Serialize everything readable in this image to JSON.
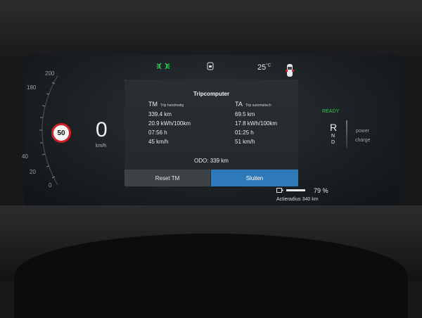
{
  "status_bar": {
    "temperature": "25",
    "temperature_unit": "°C",
    "icons": [
      "headlights-icon",
      "car-front-icon",
      "car-top-view-icon"
    ]
  },
  "speedometer": {
    "speed": "0",
    "unit": "km/h",
    "speed_limit": "50",
    "scale_labels": [
      "200",
      "180",
      "40",
      "20",
      "0"
    ]
  },
  "trip_computer": {
    "title": "Tripcomputer",
    "tm": {
      "code": "TM",
      "name": "Trip handmatig",
      "rows": [
        "339.4 km",
        "20.9 kWh/100km",
        "07:56 h",
        "45 km/h"
      ]
    },
    "ta": {
      "code": "TA",
      "name": "Trip automatisch",
      "rows": [
        "69.5 km",
        "17.8 kWh/100km",
        "01:25 h",
        "51 km/h"
      ]
    },
    "odo": "ODO:  339 km",
    "reset_label": "Reset TM",
    "close_label": "Sluiten"
  },
  "drive": {
    "ready": "READY",
    "gear_active": "R",
    "gear_n": "N",
    "gear_d": "D",
    "power_label": "power",
    "charge_label": "charge"
  },
  "battery": {
    "percent": "79 %",
    "level": 0.79,
    "range": "Actieradius 340 km",
    "colors": {
      "ready": "#27d24a",
      "accent": "#2e7ab8",
      "limit_ring": "#d0202a"
    }
  }
}
